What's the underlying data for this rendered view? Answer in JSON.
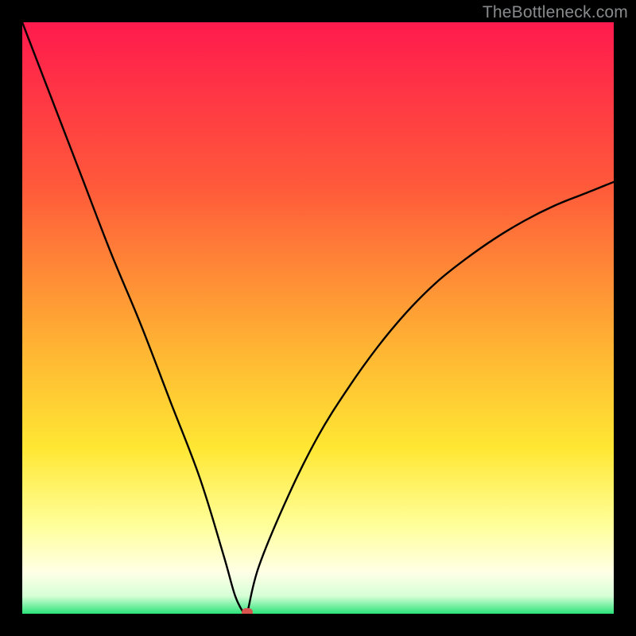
{
  "watermark": "TheBottleneck.com",
  "colors": {
    "top_red": "#ff1a4d",
    "mid_orange": "#ff7a33",
    "yellow": "#ffe733",
    "pale_yellow": "#ffffb3",
    "cream": "#ffffe6",
    "green": "#2be37a",
    "frame": "#000000",
    "curve": "#000000",
    "marker": "#d9544f"
  },
  "chart_data": {
    "type": "line",
    "title": "",
    "xlabel": "",
    "ylabel": "",
    "xlim": [
      0,
      100
    ],
    "ylim": [
      0,
      100
    ],
    "grid": false,
    "series": [
      {
        "name": "bottleneck-curve",
        "x": [
          0,
          5,
          10,
          15,
          20,
          25,
          30,
          34,
          36,
          37.5,
          38,
          40,
          45,
          50,
          55,
          60,
          65,
          70,
          75,
          80,
          85,
          90,
          95,
          100
        ],
        "y": [
          100,
          87,
          74,
          61,
          49,
          36,
          23,
          10,
          3,
          0,
          0,
          8,
          20,
          30,
          38,
          45,
          51,
          56,
          60,
          63.5,
          66.5,
          69,
          71,
          73
        ]
      }
    ],
    "marker": {
      "x": 38,
      "y": 0
    },
    "note": "Values are read off the figure; no axis ticks or labels are visible."
  }
}
